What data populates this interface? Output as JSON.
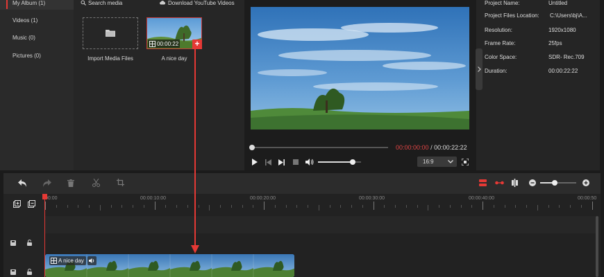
{
  "album": {
    "items": [
      {
        "label": "My Album (1)",
        "active": true
      },
      {
        "label": "Videos (1)",
        "active": false
      },
      {
        "label": "Music (0)",
        "active": false
      },
      {
        "label": "Pictures (0)",
        "active": false
      }
    ]
  },
  "media": {
    "search_label": "Search media",
    "download_label": "Download YouTube Videos",
    "import_label": "Import Media Files",
    "clip_name": "A nice day",
    "clip_duration": "00:00:22"
  },
  "player": {
    "current_time": "00:00:00:00",
    "separator": "/",
    "total_time": "00:00:22:22",
    "aspect_ratio": "16:9",
    "progress": 0,
    "volume": 0.8
  },
  "properties": {
    "rows": [
      {
        "key": "Project Name:",
        "value": "Untitled"
      },
      {
        "key": "Project Files Location:",
        "value": "C:\\Users\\bj\\A..."
      },
      {
        "key": "Resolution:",
        "value": "1920x1080"
      },
      {
        "key": "Frame Rate:",
        "value": "25fps"
      },
      {
        "key": "Color Space:",
        "value": "SDR- Rec.709"
      },
      {
        "key": "Duration:",
        "value": "00:00:22:22"
      }
    ]
  },
  "timeline": {
    "ruler_labels": [
      "00:00",
      "00:00:10:00",
      "00:00:20:00",
      "00:00:30:00",
      "00:00:40:00",
      "00:00:50"
    ],
    "clip_label": "A nice day",
    "zoom_level": 0.4
  },
  "colors": {
    "accent_red": "#e53935",
    "time_red": "#e04545",
    "panel_bg": "#262626"
  }
}
